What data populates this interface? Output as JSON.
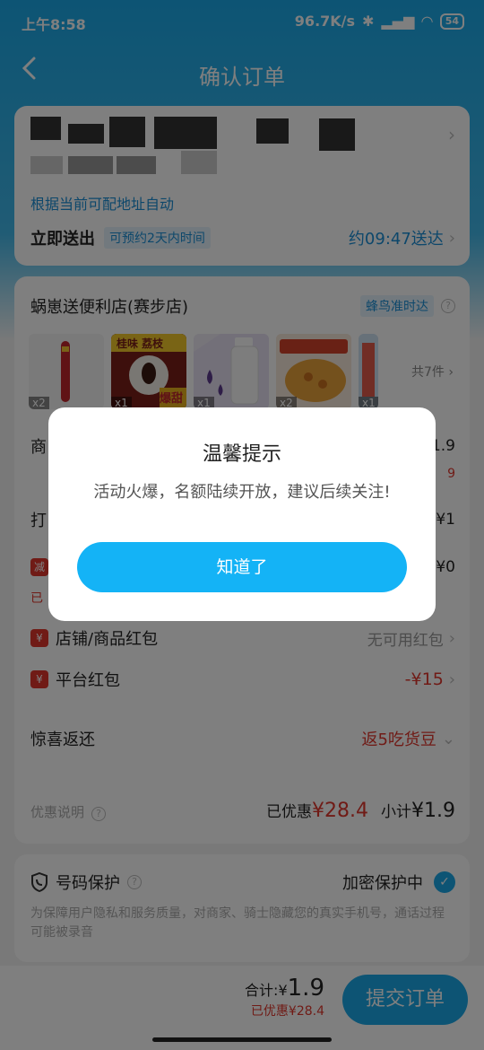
{
  "status": {
    "time": "上午8:58",
    "network": "96.7K/s",
    "battery": "54"
  },
  "nav": {
    "title": "确认订单"
  },
  "address": {
    "hint": "根据当前可配地址自动",
    "deliver_now": "立即送出",
    "deliver_tag": "可预约2天内时间",
    "eta": "约09:47送达"
  },
  "store": {
    "name": "蜗崽送便利店(赛步店)",
    "tag": "蜂鸟准时达",
    "goods": [
      {
        "qty": "x2",
        "icon": "sausage"
      },
      {
        "qty": "x1",
        "icon": "lychee-drink",
        "banner": "桂味 荔枝",
        "flash": "爆甜"
      },
      {
        "qty": "x1",
        "icon": "water-bottle"
      },
      {
        "qty": "x2",
        "icon": "snack-bag"
      },
      {
        "qty": "x1",
        "icon": "item"
      }
    ],
    "goods_count": "共7件"
  },
  "rows": {
    "r1_label": "商",
    "r1_val": "1.9",
    "r1_sub": "9",
    "r2_label": "打",
    "r2_val": "¥1",
    "r3_badge": "减",
    "r3_val": "¥0",
    "r3_sub": "已",
    "shop_coupon_badge": "¥",
    "shop_coupon": "店铺/商品红包",
    "shop_coupon_val": "无可用红包",
    "platform_badge": "¥",
    "platform": "平台红包",
    "platform_val": "-¥15",
    "surprise": "惊喜返还",
    "surprise_val": "返5吃货豆"
  },
  "summary": {
    "label": "优惠说明",
    "saved_label": "已优惠",
    "saved_amt": "¥28.4",
    "sub_label": "小计",
    "sub_amt": "¥1.9"
  },
  "privacy": {
    "title": "号码保护",
    "status": "加密保护中",
    "desc": "为保障用户隐私和服务质量，对商家、骑士隐藏您的真实手机号，通话过程可能被录音"
  },
  "bottom": {
    "total_label": "合计:",
    "total_currency": "¥",
    "total": "1.9",
    "saved": "已优惠¥28.4",
    "submit": "提交订单"
  },
  "modal": {
    "title": "温馨提示",
    "message": "活动火爆，名额陆续开放，建议后续关注!",
    "button": "知道了"
  },
  "colors": {
    "brand": "#1aa9e8",
    "accent_red": "#e0362d",
    "button": "#14b3f6"
  }
}
